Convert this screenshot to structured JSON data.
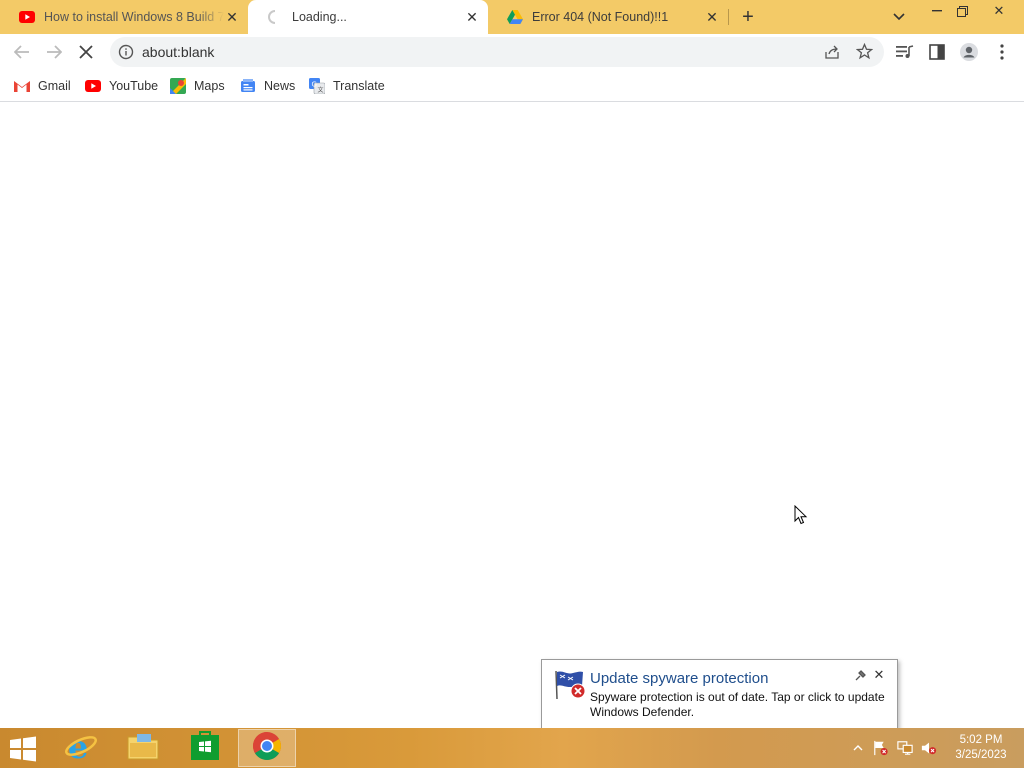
{
  "browser": {
    "tabs": [
      {
        "title": "How to install Windows 8 Build 7",
        "favicon": "youtube-icon",
        "state": "normal"
      },
      {
        "title": "Loading...",
        "favicon": "loading-spinner-icon",
        "state": "active"
      },
      {
        "title": "Error 404 (Not Found)!!1",
        "favicon": "google-drive-icon",
        "state": "normal"
      }
    ],
    "address": "about:blank",
    "bookmarks": [
      {
        "label": "Gmail",
        "icon": "gmail-icon"
      },
      {
        "label": "YouTube",
        "icon": "youtube-icon"
      },
      {
        "label": "Maps",
        "icon": "maps-icon"
      },
      {
        "label": "News",
        "icon": "news-icon"
      },
      {
        "label": "Translate",
        "icon": "translate-icon"
      }
    ]
  },
  "notification": {
    "title": "Update spyware protection",
    "message": "Spyware protection is out of date. Tap or click to update Windows Defender."
  },
  "taskbar": {
    "apps": [
      "internet-explorer-icon",
      "file-explorer-icon",
      "store-icon",
      "chrome-icon"
    ],
    "time": "5:02 PM",
    "date": "3/25/2023"
  },
  "colors": {
    "tabstrip": "#f3ca67",
    "taskbar": "#d99a3a",
    "notification_title": "#1f4e8c"
  }
}
